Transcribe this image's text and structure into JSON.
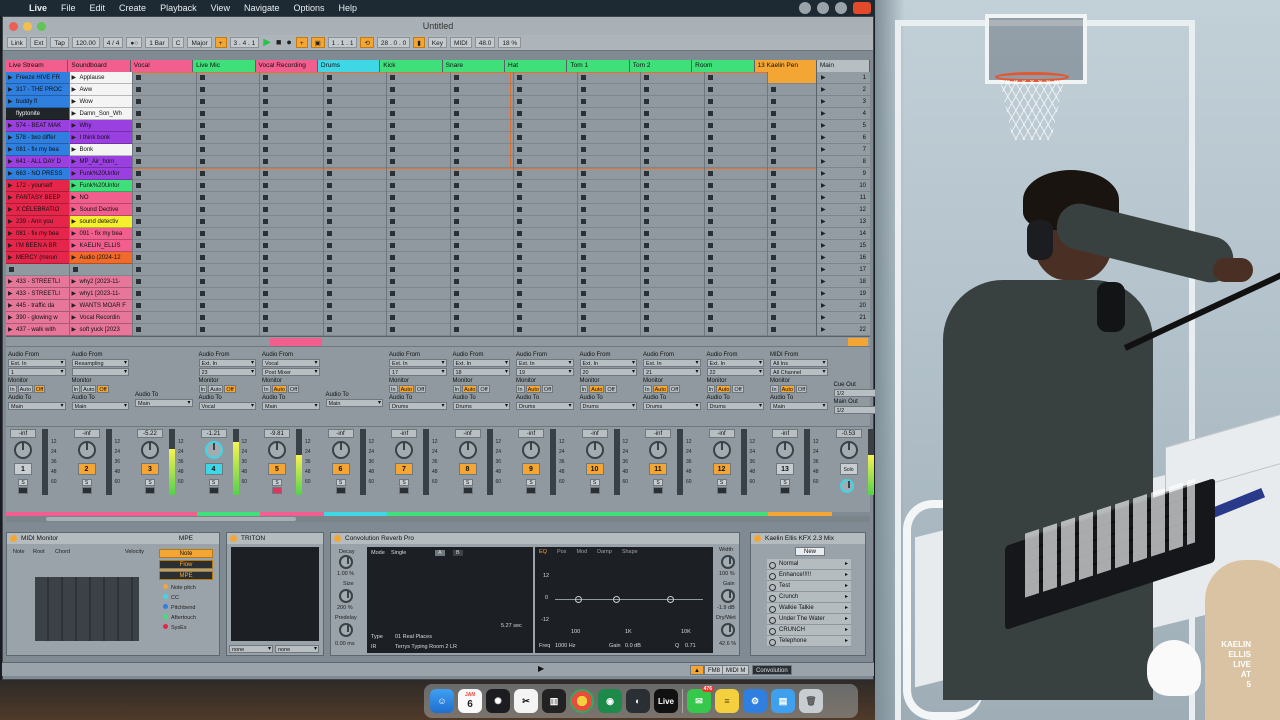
{
  "menubar": {
    "items": [
      "Live",
      "File",
      "Edit",
      "Create",
      "Playback",
      "View",
      "Navigate",
      "Options",
      "Help"
    ]
  },
  "window": {
    "title": "Untitled"
  },
  "controlbar": {
    "link": "Link",
    "ext": "Ext",
    "tap": "Tap",
    "tempo": "120.00",
    "time_sig": "4 / 4",
    "quantize": "1 Bar",
    "key": "C",
    "scale": "Major",
    "position": "3 . 4 . 1",
    "loop_start": "1 . 1 . 1",
    "loop_length": "28 . 0 . 0",
    "key_label": "Key",
    "midi_label": "MIDI",
    "sample_rate": "48.0",
    "cpu": "18 %"
  },
  "tracks": [
    {
      "name": "Live Stream",
      "color": "#f25f8f"
    },
    {
      "name": "Soundboard",
      "color": "#f25f8f"
    },
    {
      "name": "Vocal",
      "color": "#f25f8f"
    },
    {
      "name": "Live Mic",
      "color": "#3fe07a"
    },
    {
      "name": "Vocal Recording",
      "color": "#f25f8f"
    },
    {
      "name": "Drums",
      "color": "#3fd6e6"
    },
    {
      "name": "Kick",
      "color": "#3fe07a"
    },
    {
      "name": "Snare",
      "color": "#3fe07a"
    },
    {
      "name": "Hat",
      "color": "#3fe07a"
    },
    {
      "name": "Tom 1",
      "color": "#3fe07a"
    },
    {
      "name": "Tom 2",
      "color": "#3fe07a"
    },
    {
      "name": "Room",
      "color": "#3fe07a"
    },
    {
      "name": "13 Kaelin Pen",
      "color": "#f3a634"
    }
  ],
  "master": {
    "name": "Main",
    "color": "#b8bfc3"
  },
  "clips_col0": [
    {
      "name": "Freeze HIVE FR",
      "color": "#2e7fe0"
    },
    {
      "name": "317 - THE PROC",
      "color": "#2e7fe0"
    },
    {
      "name": "buddy fl",
      "color": "#2e7fe0"
    },
    {
      "name": "flyptonite",
      "color": "#20252a"
    },
    {
      "name": "574 - BEAT MAK",
      "color": "#9a3fe0"
    },
    {
      "name": "578 - two differ",
      "color": "#2e7fe0"
    },
    {
      "name": "081 - fix my bea",
      "color": "#2e7fe0"
    },
    {
      "name": "641 - ALL DAY D",
      "color": "#9a3fe0"
    },
    {
      "name": "663 - NO PRESS",
      "color": "#2e7fe0"
    },
    {
      "name": "172 - yourself",
      "color": "#e6254a"
    },
    {
      "name": "FANTASY BEEP",
      "color": "#e6254a"
    },
    {
      "name": "X CELEBRATIO",
      "color": "#e6254a"
    },
    {
      "name": "239 - Ann you",
      "color": "#e6254a"
    },
    {
      "name": "081 - fix my bea",
      "color": "#e6254a"
    },
    {
      "name": "I'M BEEN A BR",
      "color": "#e6254a"
    },
    {
      "name": "MERCY (rrerun",
      "color": "#e6254a"
    },
    {
      "name": "",
      "color": ""
    },
    {
      "name": "433 - STREETLI",
      "color": "#e6779a"
    },
    {
      "name": "433 - STREETLI",
      "color": "#e6779a"
    },
    {
      "name": "445 - traffic da",
      "color": "#e6779a"
    },
    {
      "name": "390 - glowing w",
      "color": "#e6779a"
    },
    {
      "name": "437 - walk with",
      "color": "#e6779a"
    }
  ],
  "clips_col1": [
    {
      "name": "Applause",
      "color": "#f4f4f4"
    },
    {
      "name": "Aww",
      "color": "#f4f4f4"
    },
    {
      "name": "Wow",
      "color": "#f4f4f4"
    },
    {
      "name": "Damn_Son_Wh",
      "color": "#f4f4f4"
    },
    {
      "name": "Why",
      "color": "#9a3fe0"
    },
    {
      "name": "I think bonk",
      "color": "#9a3fe0"
    },
    {
      "name": "Bonk",
      "color": "#f4f4f4"
    },
    {
      "name": "MP_Air_horn_",
      "color": "#9a3fe0"
    },
    {
      "name": "Funk%20Unfor",
      "color": "#9a3fe0"
    },
    {
      "name": "Funk%20Unfor",
      "color": "#3fe07a"
    },
    {
      "name": "NO",
      "color": "#f25f8f"
    },
    {
      "name": "Sound Dective",
      "color": "#f25f8f"
    },
    {
      "name": "sound detectiv",
      "color": "#f4f030"
    },
    {
      "name": "091 - fix my bea",
      "color": "#f25f8f"
    },
    {
      "name": "KAELIN_ELLIS",
      "color": "#f25f8f"
    },
    {
      "name": "Audio (2024-12",
      "color": "#f06a2a"
    },
    {
      "name": "",
      "color": ""
    },
    {
      "name": "why2 [2023-11-",
      "color": "#e6779a"
    },
    {
      "name": "why1 [2023-11-",
      "color": "#e6779a"
    },
    {
      "name": "WANTS MOAR F",
      "color": "#e6779a"
    },
    {
      "name": "Vocal Recordin",
      "color": "#e6779a"
    },
    {
      "name": "soft yuck [2023",
      "color": "#e6779a"
    }
  ],
  "scenes": [
    "1",
    "2",
    "3",
    "4",
    "5",
    "6",
    "7",
    "8",
    "9",
    "10",
    "11",
    "12",
    "13",
    "14",
    "15",
    "16",
    "17",
    "18",
    "19",
    "20",
    "21",
    "22"
  ],
  "io": {
    "audio_from": "Audio From",
    "audio_to": "Audio To",
    "monitor": "Monitor",
    "midi_from": "MIDI From",
    "in": "In",
    "auto": "Auto",
    "off": "Off",
    "cue_out": "Cue Out",
    "main_out": "Main Out",
    "cue_val": "1/2",
    "main_val": "1/2",
    "strips": [
      {
        "from": "Ext. In",
        "ch": "1",
        "to": "Main",
        "mon": "off",
        "type": "audio"
      },
      {
        "from": "Resampling",
        "ch": "",
        "to": "Main",
        "mon": "off",
        "type": "audio"
      },
      {
        "from": "",
        "ch": "",
        "to": "Main",
        "mon": "",
        "type": "return"
      },
      {
        "from": "Ext. In",
        "ch": "23",
        "to": "Vocal",
        "mon": "off",
        "type": "audio"
      },
      {
        "from": "Vocal",
        "ch": "Post Mixer",
        "to": "Main",
        "mon": "auto",
        "type": "audio"
      },
      {
        "from": "",
        "ch": "",
        "to": "Main",
        "mon": "",
        "type": "return"
      },
      {
        "from": "Ext. In",
        "ch": "17",
        "to": "Drums",
        "mon": "auto",
        "type": "audio"
      },
      {
        "from": "Ext. In",
        "ch": "18",
        "to": "Drums",
        "mon": "auto",
        "type": "audio"
      },
      {
        "from": "Ext. In",
        "ch": "19",
        "to": "Drums",
        "mon": "auto",
        "type": "audio"
      },
      {
        "from": "Ext. In",
        "ch": "20",
        "to": "Drums",
        "mon": "auto",
        "type": "audio"
      },
      {
        "from": "Ext. In",
        "ch": "21",
        "to": "Drums",
        "mon": "auto",
        "type": "audio"
      },
      {
        "from": "Ext. In",
        "ch": "22",
        "to": "Drums",
        "mon": "auto",
        "type": "audio"
      },
      {
        "from": "All Ins",
        "ch": "All Channel",
        "to": "Main",
        "mon": "auto",
        "type": "midi"
      }
    ]
  },
  "mixer": {
    "strips": [
      {
        "vol": "-inf",
        "num": "1",
        "numcolor": "#c7cdd0",
        "level": 0
      },
      {
        "vol": "-inf",
        "num": "2",
        "numcolor": "#f3a634",
        "level": 0
      },
      {
        "vol": "-5.22",
        "num": "3",
        "numcolor": "#f3a634",
        "level": 0.7
      },
      {
        "vol": "-1.21",
        "num": "4",
        "numcolor": "#3fd6e6",
        "level": 0.8
      },
      {
        "vol": "-9.81",
        "num": "5",
        "numcolor": "#f3a634",
        "level": 0.6
      },
      {
        "vol": "-inf",
        "num": "6",
        "numcolor": "#f3a634",
        "level": 0
      },
      {
        "vol": "-inf",
        "num": "7",
        "numcolor": "#f3a634",
        "level": 0
      },
      {
        "vol": "-inf",
        "num": "8",
        "numcolor": "#f3a634",
        "level": 0
      },
      {
        "vol": "-inf",
        "num": "9",
        "numcolor": "#f3a634",
        "level": 0
      },
      {
        "vol": "-inf",
        "num": "10",
        "numcolor": "#f3a634",
        "level": 0
      },
      {
        "vol": "-inf",
        "num": "11",
        "numcolor": "#f3a634",
        "level": 0
      },
      {
        "vol": "-inf",
        "num": "12",
        "numcolor": "#f3a634",
        "level": 0
      },
      {
        "vol": "-inf",
        "num": "13",
        "numcolor": "#c7cdd0",
        "level": 0
      }
    ],
    "master_vol": "-0.53",
    "solo": "Solo",
    "scale": [
      "12",
      "24",
      "36",
      "48",
      "60"
    ]
  },
  "devices": {
    "midi_monitor": {
      "title": "MIDI Monitor",
      "mpe": "MPE",
      "cols": [
        "Note",
        "Root",
        "Chord",
        "Velocity"
      ],
      "modes": [
        "Note",
        "Flow",
        "MPE"
      ],
      "legend": [
        {
          "label": "Note pitch",
          "color": "#f3a634"
        },
        {
          "label": "CC",
          "color": "#3fd6e6"
        },
        {
          "label": "Pitchbend",
          "color": "#2e7fe0"
        },
        {
          "label": "Aftertouch",
          "color": "#3fe07a"
        },
        {
          "label": "SysEx",
          "color": "#e6254a"
        }
      ]
    },
    "triton": {
      "title": "TRITON",
      "none1": "none",
      "none2": "none"
    },
    "reverb": {
      "title": "Convolution Reverb Pro",
      "decay": "Decay",
      "decay_val": "1.00 %",
      "size": "Size",
      "size_val": "200 %",
      "predelay": "Predelay",
      "predelay_val": "0.00 ms",
      "mode": "Mode",
      "mode_val": "Single",
      "a": "A",
      "b": "B",
      "time": "5.27 sec",
      "type": "Type",
      "type_val": "01 Real Places",
      "ir": "IR",
      "ir_val": "Terrys Typing Room 2 LR",
      "tabs": [
        "EQ",
        "Pos",
        "Mod",
        "Damp",
        "Shape"
      ],
      "eq_ticks": [
        "12",
        "0",
        "-12"
      ],
      "freq_ticks": [
        "100",
        "1K",
        "10K"
      ],
      "freq": "Freq",
      "freq_val": "1000 Hz",
      "gain": "Gain",
      "gain_val": "0.0 dB",
      "q": "Q",
      "q_val": "0.71",
      "width": "Width",
      "width_val": "100 %",
      "gain2": "Gain",
      "gain2_val": "-1.9 dB",
      "drywet": "Dry/Wet",
      "drywet_val": "42.6 %"
    },
    "kfx": {
      "title": "Kaelin Ellis KFX 2.3 Mix",
      "new": "New",
      "items": [
        "Normal",
        "Enhance!!!!!",
        "Test",
        "Crunch",
        "Walkie Talkie",
        "Under The Water",
        "CRUNCH",
        "Telephone"
      ]
    }
  },
  "statusbar": {
    "tab1": "FM8",
    "tab2": "MIDI M",
    "tab3": "Convolution"
  },
  "dock": {
    "date_month": "JAN",
    "date_day": "6",
    "live_label": "Live",
    "badge": "476"
  },
  "watermark": {
    "lines": [
      "KAELIN",
      "ELLIS",
      "LIVE",
      "AT",
      "5"
    ]
  }
}
